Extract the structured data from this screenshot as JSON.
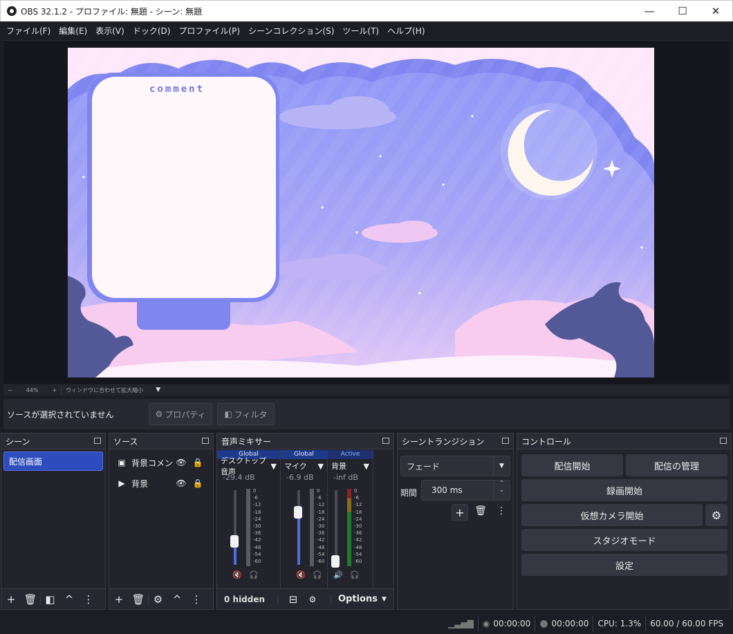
{
  "window": {
    "title": "OBS 32.1.2 - プロファイル: 無題 - シーン: 無題",
    "min": "—",
    "max": "☐",
    "close": "✕"
  },
  "menu": [
    "ファイル(F)",
    "編集(E)",
    "表示(V)",
    "ドック(D)",
    "プロファイル(P)",
    "シーンコレクション(S)",
    "ツール(T)",
    "ヘルプ(H)"
  ],
  "preview": {
    "comment_label": "comment"
  },
  "zoom": {
    "minus": "−",
    "value": "44%",
    "plus": "+",
    "fit_label": "ウィンドウに合わせて拡大縮小"
  },
  "source_toolbar": {
    "no_selection": "ソースが選択されていません",
    "properties": "プロパティ",
    "filters": "フィルタ"
  },
  "scenes": {
    "title": "シーン",
    "items": [
      "配信画面"
    ]
  },
  "sources": {
    "title": "ソース",
    "items": [
      {
        "name": "背景コメント",
        "icon": "image-icon"
      },
      {
        "name": "背景",
        "icon": "play-icon"
      }
    ]
  },
  "mixer": {
    "title": "音声ミキサー",
    "channels": [
      {
        "badge": "Global",
        "name": "デスクトップ音声",
        "db": "-29.4 dB",
        "level": 0.32,
        "muted": true
      },
      {
        "badge": "Global",
        "name": "マイク",
        "db": "-6.9 dB",
        "level": 0.71,
        "muted": true
      },
      {
        "badge": "Active",
        "name": "背景",
        "db": "-inf dB",
        "level": 0.06,
        "muted": false
      }
    ],
    "scale": [
      "0",
      "-6",
      "-12",
      "-18",
      "-24",
      "-30",
      "-36",
      "-42",
      "-48",
      "-54",
      "-60"
    ],
    "hidden": "0 hidden",
    "options": "Options"
  },
  "transitions": {
    "title": "シーントランジション",
    "type": "フェード",
    "duration_label": "期間",
    "duration": "300 ms"
  },
  "controls": {
    "title": "コントロール",
    "start_stream": "配信開始",
    "manage_stream": "配信の管理",
    "start_record": "録画開始",
    "start_virtualcam": "仮想カメラ開始",
    "studio_mode": "スタジオモード",
    "settings": "設定"
  },
  "status": {
    "stream_time": "00:00:00",
    "record_time": "00:00:00",
    "cpu": "CPU: 1.3%",
    "fps": "60.00 / 60.00 FPS"
  }
}
